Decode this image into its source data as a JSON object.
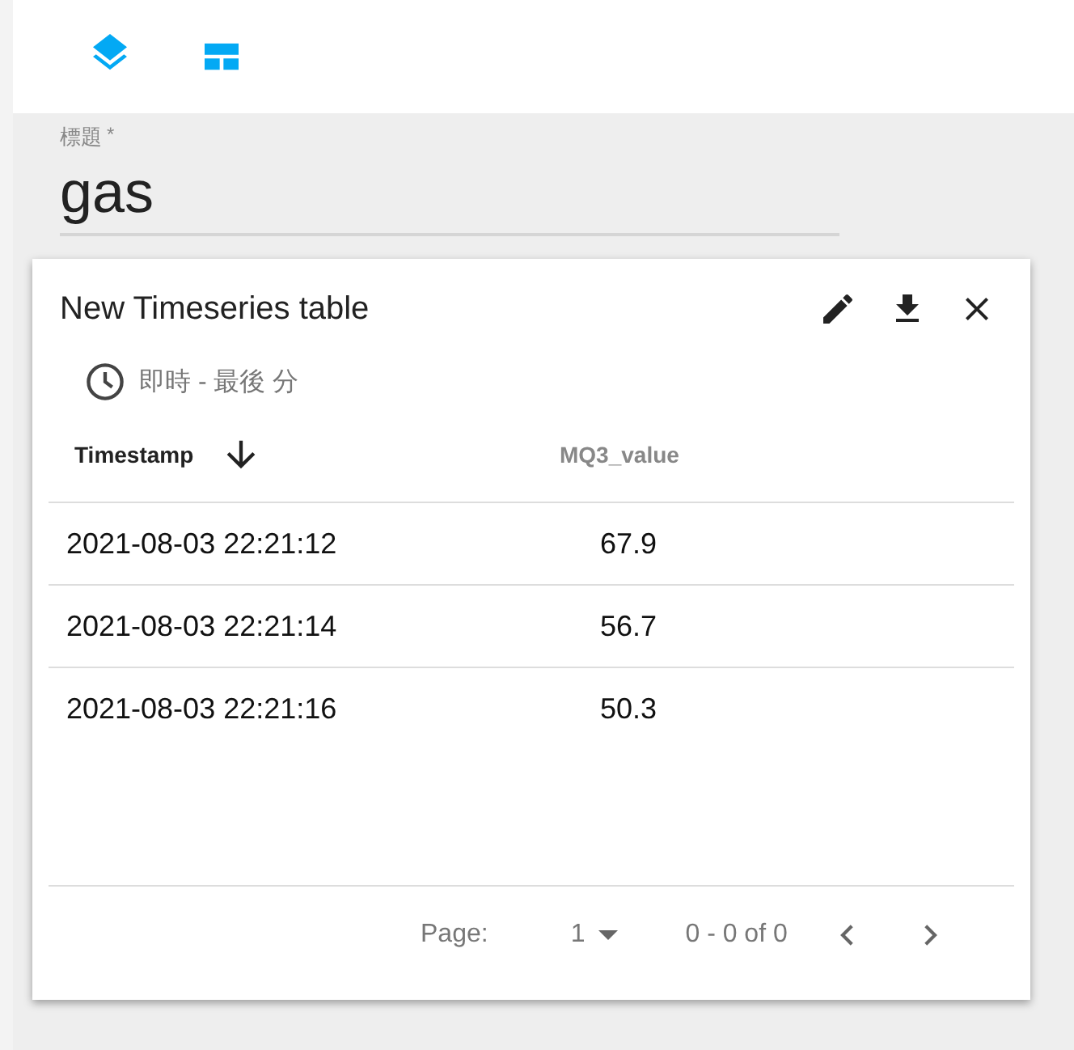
{
  "toolbar": {
    "buttons": [
      {
        "kind": "layers"
      },
      {
        "kind": "layout"
      }
    ]
  },
  "title_field": {
    "label": "標題",
    "required_mark": "*",
    "value": "gas"
  },
  "widget": {
    "title": "New Timeseries table",
    "actions": [
      {
        "kind": "edit"
      },
      {
        "kind": "download"
      },
      {
        "kind": "close"
      }
    ],
    "timewindow": "即時 - 最後 分",
    "table": {
      "columns": [
        {
          "label": "Timestamp",
          "sorted": true
        },
        {
          "label": "MQ3_value",
          "sorted": false
        }
      ],
      "rows": [
        [
          "2021-08-03 22:21:12",
          "67.9"
        ],
        [
          "2021-08-03 22:21:14",
          "56.7"
        ],
        [
          "2021-08-03 22:21:16",
          "50.3"
        ]
      ]
    },
    "pager": {
      "label": "Page:",
      "page": "1",
      "range": "0 - 0 of 0"
    }
  }
}
